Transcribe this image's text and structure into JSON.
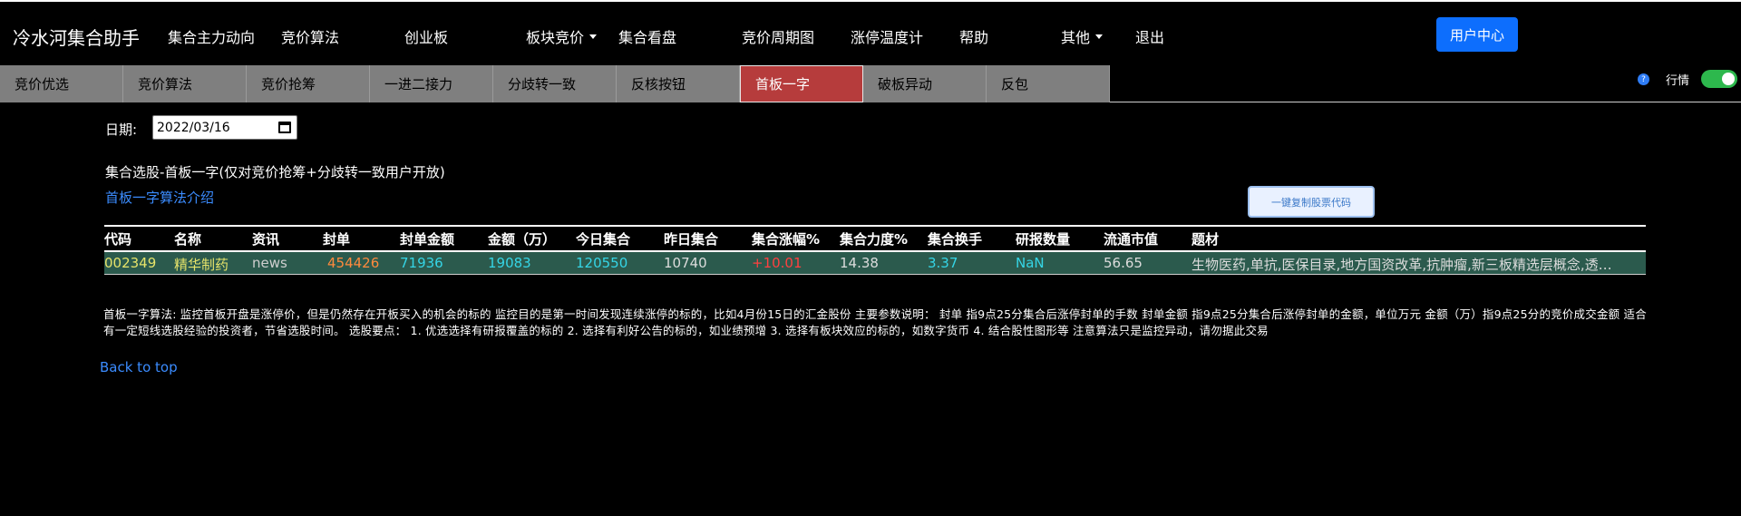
{
  "header": {
    "brand": "冷水河集合助手",
    "nav": [
      {
        "label": "集合主力动向"
      },
      {
        "label": "竞价算法"
      },
      {
        "label": "创业板"
      },
      {
        "label": "板块竞价",
        "dropdown": true
      },
      {
        "label": "集合看盘"
      },
      {
        "label": "竞价周期图"
      },
      {
        "label": "涨停温度计"
      },
      {
        "label": "帮助"
      },
      {
        "label": "其他",
        "dropdown": true
      },
      {
        "label": "退出"
      }
    ],
    "user_center": "用户中心"
  },
  "tabs": [
    {
      "label": "竞价优选",
      "active": false
    },
    {
      "label": "竞价算法",
      "active": false
    },
    {
      "label": "竞价抢筹",
      "active": false
    },
    {
      "label": "一进二接力",
      "active": false
    },
    {
      "label": "分歧转一致",
      "active": false
    },
    {
      "label": "反核按钮",
      "active": false
    },
    {
      "label": "首板一字",
      "active": true
    },
    {
      "label": "破板异动",
      "active": false
    },
    {
      "label": "反包",
      "active": false
    }
  ],
  "toggle": {
    "help_icon": "?",
    "label": "行情",
    "on": true
  },
  "date": {
    "label": "日期:",
    "value": "2022/03/16"
  },
  "section": {
    "title": "集合选股-首板一字(仅对竞价抢筹+分歧转一致用户开放)",
    "intro_link": "首板一字算法介绍",
    "copy_button": "一键复制股票代码"
  },
  "table": {
    "headers": [
      "代码",
      "名称",
      "资讯",
      "封单",
      "封单金额",
      "金额（万）",
      "今日集合",
      "昨日集合",
      "集合涨幅%",
      "集合力度%",
      "集合换手",
      "研报数量",
      "流通市值",
      "题材"
    ],
    "rows": [
      [
        "002349",
        "精华制药",
        "news",
        "454426",
        "71936",
        "19083",
        "120550",
        "10740",
        "+10.01",
        "14.38",
        "3.37",
        "NaN",
        "56.65",
        "生物医药,单抗,医保目录,地方国资改革,抗肿瘤,新三板精选层概念,透…"
      ]
    ],
    "cell_colors": [
      "#e6e36a",
      "#e6e36a",
      "#cfcfcf",
      "#ff8a3d",
      "#35d5e6",
      "#35d5e6",
      "#35d5e6",
      "#dcdcdc",
      "#ff4040",
      "#dcdcdc",
      "#35d5e6",
      "#35d5e6",
      "#dcdcdc",
      "#dcdcdc"
    ]
  },
  "algo_text": "首板一字算法: 监控首板开盘是涨停价，但是仍然存在开板买入的机会的标的 监控目的是第一时间发现连续涨停的标的，比如4月份15日的汇金股份 主要参数说明： 封单 指9点25分集合后涨停封单的手数 封单金额 指9点25分集合后涨停封单的金额，单位万元 金额（万）指9点25分的竞价成交金额 适合有一定短线选股经验的投资者，节省选股时间。 选股要点： 1. 优选选择有研报覆盖的标的 2. 选择有利好公告的标的，如业绩预增 3. 选择有板块效应的标的，如数字货币 4. 结合股性图形等 注意算法只是监控异动，请勿据此交易",
  "back_to_top": "Back to top"
}
